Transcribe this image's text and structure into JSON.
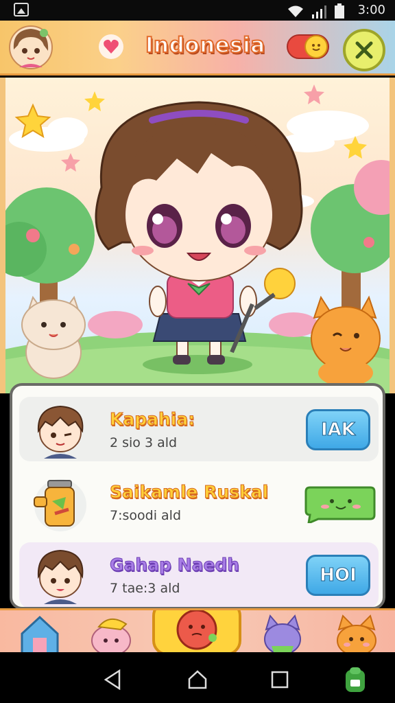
{
  "status_bar": {
    "time": "3:00"
  },
  "header": {
    "title": "Indonesia"
  },
  "list": [
    {
      "name": "Kapahia:",
      "sub": "2 sio 3 ald",
      "button": "IAK",
      "button_type": "blue"
    },
    {
      "name": "Saikamle Ruskal",
      "sub": "7:soodi ald",
      "button": "",
      "button_type": "green-cat"
    },
    {
      "name": "Gahap Naedh",
      "sub": "7 tae:3 ald",
      "button": "HOI",
      "button_type": "blue"
    }
  ],
  "colors": {
    "header_gradient": [
      "#f7c56a",
      "#a9d4e8"
    ],
    "title_stroke": "#e26b2c",
    "button_blue": "#3fa8e6",
    "button_green": "#7bd35a",
    "purple_name": "#a87de6"
  },
  "icons": {
    "header": [
      "avatar-girl-icon",
      "heart-icon",
      "toggle-sun-icon",
      "close-icon"
    ],
    "dock": [
      "house-icon",
      "pig-icon",
      "tomato-camera-icon",
      "cat-purple-icon",
      "cat-orange-icon"
    ],
    "nav": [
      "back-triangle-icon",
      "home-icon",
      "recents-square-icon",
      "android-icon"
    ]
  }
}
